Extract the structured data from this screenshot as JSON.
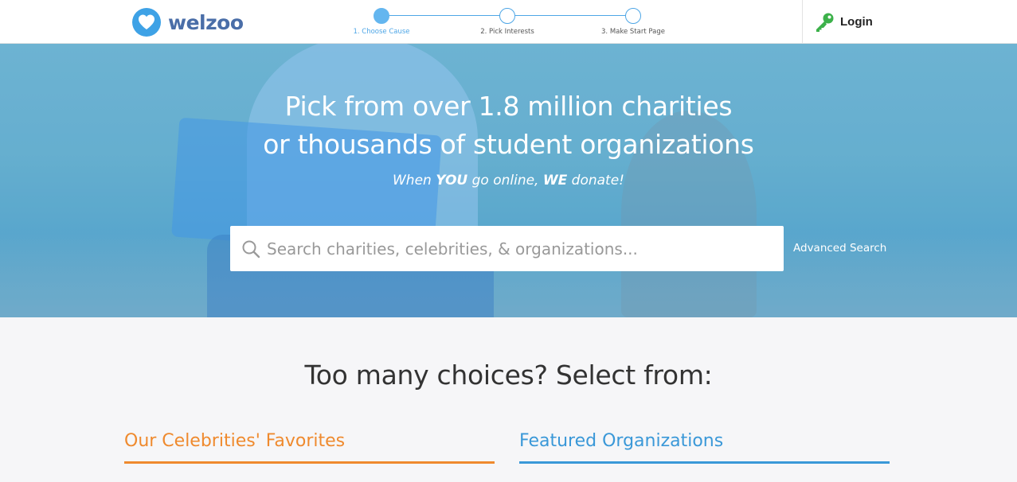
{
  "colors": {
    "accent_blue": "#4ea6e6",
    "brand_blue": "#4a6ea8",
    "celebrities_orange": "#ef8a2e",
    "featured_blue": "#3a98d8",
    "key_green": "#3cb14a"
  },
  "header": {
    "brand": "welzoo",
    "steps": [
      {
        "label": "1. Choose Cause",
        "active": true
      },
      {
        "label": "2. Pick Interests",
        "active": false
      },
      {
        "label": "3. Make Start Page",
        "active": false
      }
    ],
    "login": {
      "label": "Login",
      "icon": "key-icon"
    }
  },
  "hero": {
    "title_line1": "Pick from over 1.8 million charities",
    "title_line2": "or thousands of student organizations",
    "tagline": {
      "part1": "When ",
      "you": "YOU",
      "part2": " go online, ",
      "we": "WE",
      "part3": " donate!"
    },
    "search": {
      "placeholder": "Search charities, celebrities, & organizations...",
      "value": "",
      "icon": "search-icon"
    },
    "advanced_search": "Advanced Search"
  },
  "choices": {
    "title": "Too many choices? Select from:",
    "celebrities": "Our Celebrities' Favorites",
    "featured": "Featured Organizations"
  }
}
